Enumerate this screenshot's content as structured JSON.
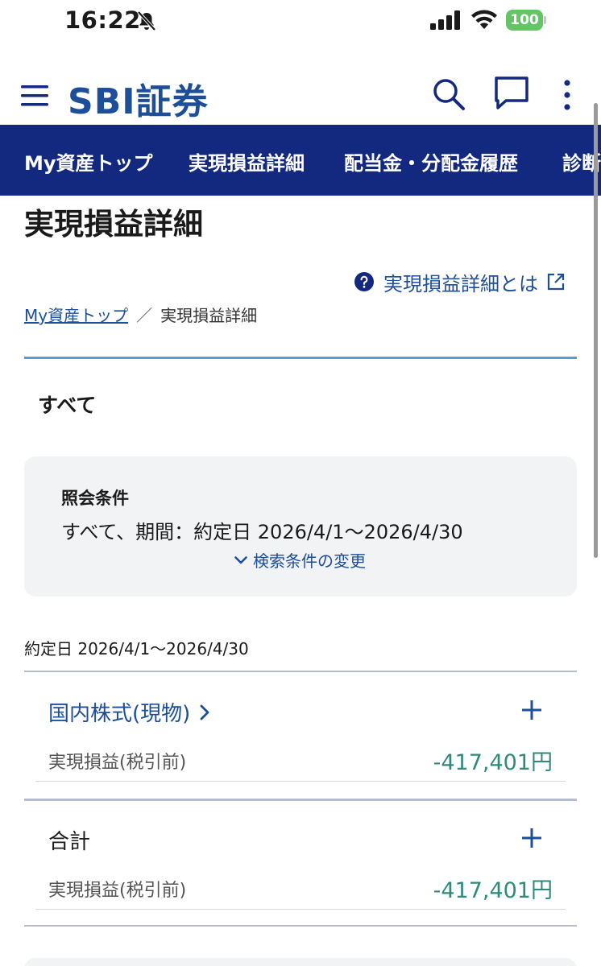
{
  "status": {
    "time": "16:22",
    "battery": "100",
    "icons": [
      "bell-slash-icon",
      "signal-icon",
      "wifi-icon",
      "battery-icon"
    ]
  },
  "header": {
    "logo": "SBI証券",
    "icons": [
      "menu-icon",
      "search-icon",
      "chat-icon",
      "kebab-icon"
    ]
  },
  "nav": {
    "items": [
      "My資産トップ",
      "実現損益詳細",
      "配当金・分配金履歴",
      "診断"
    ]
  },
  "page": {
    "title": "実現損益詳細",
    "help_link": "実現損益詳細とは"
  },
  "breadcrumb": {
    "home": "My資産トップ",
    "separator": "／",
    "current": "実現損益詳細"
  },
  "filter": {
    "tab": "すべて",
    "cond_label": "照会条件",
    "cond_value": "すべて、期間：約定日 2026/4/1〜2026/4/30",
    "change_label": "検索条件の変更"
  },
  "results": {
    "period": "約定日 2026/4/1〜2026/4/30",
    "sections": [
      {
        "title": "国内株式(現物)",
        "label": "実現損益(税引前)",
        "value": "-417,401円"
      },
      {
        "title": "合計",
        "label": "実現損益(税引前)",
        "value": "-417,401円"
      }
    ]
  },
  "colors": {
    "brand": "#1c4e9a",
    "nav_bg": "#13297f",
    "value": "#2f8a7a",
    "battery": "#65c466"
  }
}
